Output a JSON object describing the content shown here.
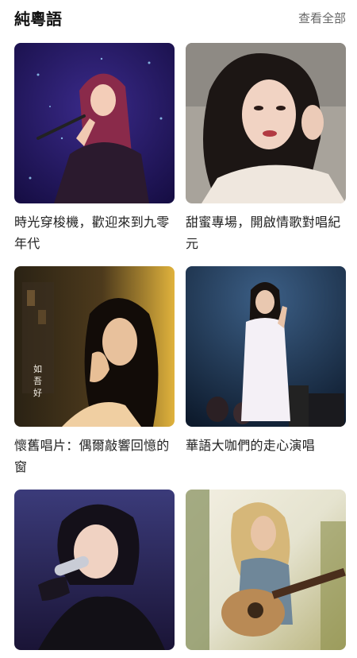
{
  "section": {
    "title": "純粵語",
    "view_all": "查看全部"
  },
  "playlists": [
    {
      "caption": "時光穿梭機，歡迎來到九零年代"
    },
    {
      "caption": "甜蜜專場，開啟情歌對唱紀元"
    },
    {
      "caption": "懷舊唱片：偶爾敲響回憶的窗",
      "overlay_text": "如 吾 好"
    },
    {
      "caption": "華語大咖們的走心演唱"
    },
    {
      "caption": ""
    },
    {
      "caption": ""
    }
  ]
}
